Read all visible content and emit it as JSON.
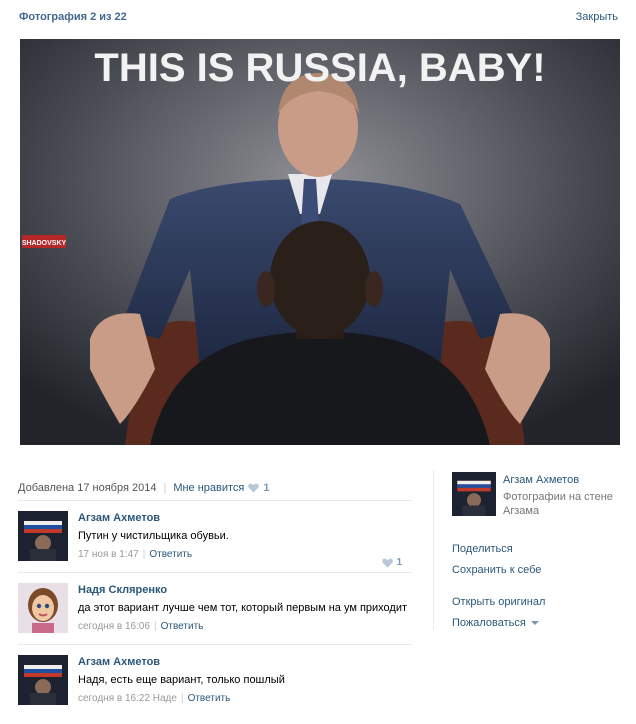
{
  "header": {
    "title": "Фотография 2 из 22",
    "close_label": "Закрыть"
  },
  "photo": {
    "caption_text": "THIS IS RUSSIA, BABY!",
    "watermark": "SHADOVSKY"
  },
  "meta": {
    "added_label": "Добавлена 17 ноября 2014",
    "like_label": "Мне нравится",
    "like_count": "1"
  },
  "comments": [
    {
      "author": "Агзам Ахметов",
      "text": "Путин у чистильщика обувьи.",
      "time": "17 ноя в 1:47",
      "reply": "Ответить",
      "likes": "1"
    },
    {
      "author": "Надя Скляренко",
      "text": "да этот вариант лучше чем тот, который первым на ум приходит",
      "time": "сегодня в 16:06",
      "reply": "Ответить"
    },
    {
      "author": "Агзам Ахметов",
      "text": "Надя, есть еще вариант, только пошлый",
      "time": "сегодня в 16:22 Наде",
      "reply": "Ответить"
    }
  ],
  "sidebar": {
    "owner_name": "Агзам Ахметов",
    "owner_sub": "Фотографии на стене Агзама",
    "share": "Поделиться",
    "save": "Сохранить к себе",
    "open_original": "Открыть оригинал",
    "report": "Пожаловаться"
  },
  "colors": {
    "link": "#2b587a",
    "accent": "#45688e",
    "muted": "#999999",
    "like": "#7898b5"
  },
  "icons": {
    "heart": "heart-icon",
    "caret": "caret-down-icon"
  }
}
